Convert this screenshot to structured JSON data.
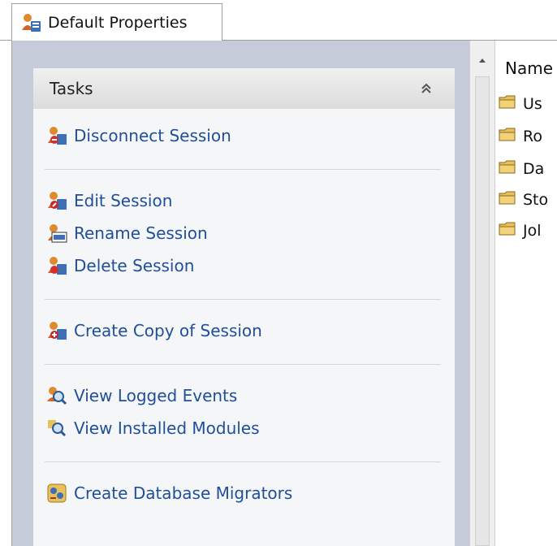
{
  "tab": {
    "label": "Default Properties"
  },
  "tasks": {
    "title": "Tasks",
    "items": [
      {
        "label": "Disconnect Session",
        "icon": "disconnect-session-icon"
      },
      {
        "label": "Edit Session",
        "icon": "edit-session-icon"
      },
      {
        "label": "Rename Session",
        "icon": "rename-session-icon"
      },
      {
        "label": "Delete Session",
        "icon": "delete-session-icon"
      },
      {
        "label": "Create Copy of Session",
        "icon": "copy-session-icon"
      },
      {
        "label": "View Logged Events",
        "icon": "logged-events-icon"
      },
      {
        "label": "View Installed Modules",
        "icon": "installed-modules-icon"
      },
      {
        "label": "Create Database Migrators",
        "icon": "database-migrators-icon"
      }
    ]
  },
  "tree": {
    "column_header": "Name",
    "items": [
      {
        "label": "Us"
      },
      {
        "label": "Ro"
      },
      {
        "label": "Da"
      },
      {
        "label": "Sto"
      },
      {
        "label": "Jol"
      }
    ]
  },
  "colors": {
    "link": "#1f4f9a",
    "pane_background": "#c5cbd8",
    "panel_background": "#f5f6f8",
    "folder": "#e8c15a"
  }
}
